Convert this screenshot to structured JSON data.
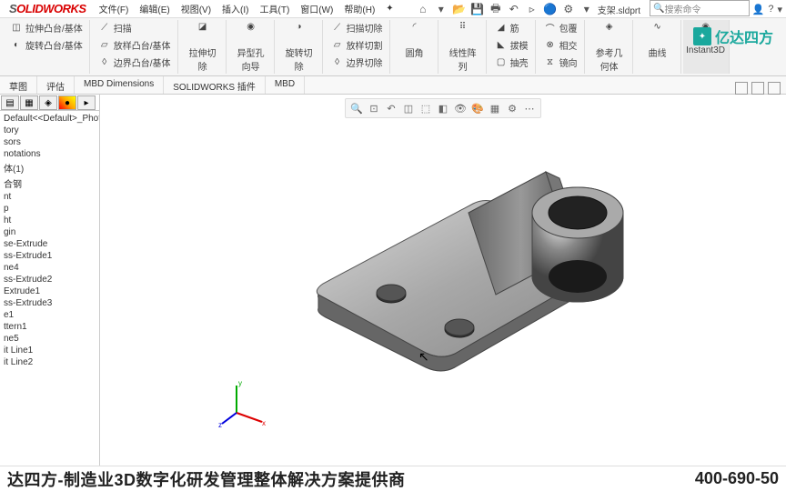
{
  "logo": {
    "solid": "OLID",
    "works": "WORKS"
  },
  "menus": [
    "文件(F)",
    "编辑(E)",
    "视图(V)",
    "插入(I)",
    "工具(T)",
    "窗口(W)",
    "帮助(H)"
  ],
  "fileName": "支架.sldprt",
  "searchPlaceholder": "搜索命令",
  "ribbon": {
    "g1": [
      [
        "拉伸凸台/基体",
        "extrude-boss"
      ],
      [
        "旋转凸台/基体",
        "revolve-boss"
      ]
    ],
    "g1b": [
      [
        "扫描",
        "sweep"
      ],
      [
        "放样凸台/基体",
        "loft"
      ],
      [
        "边界凸台/基体",
        "boundary"
      ]
    ],
    "g2": [
      [
        "拉伸切除",
        "cut-extrude"
      ],
      [
        "异型孔向导",
        "hole-wizard"
      ],
      [
        "旋转切除",
        "cut-revolve"
      ]
    ],
    "g2b": [
      [
        "扫描切除",
        "cut-sweep"
      ],
      [
        "放样切割",
        "cut-loft"
      ],
      [
        "边界切除",
        "cut-boundary"
      ]
    ],
    "g3": [
      [
        "圆角",
        "fillet"
      ],
      [
        "线性阵列",
        "pattern"
      ]
    ],
    "g4": [
      [
        "筋",
        "rib"
      ],
      [
        "拔模",
        "draft"
      ],
      [
        "抽壳",
        "shell"
      ]
    ],
    "g4b": [
      [
        "包覆",
        "wrap"
      ],
      [
        "相交",
        "intersect"
      ],
      [
        "镜向",
        "mirror"
      ]
    ],
    "g5": [
      [
        "参考几何体",
        "ref-geom"
      ],
      [
        "曲线",
        "curves"
      ]
    ],
    "instant3d": "Instant3D"
  },
  "cmdTabs": [
    "草图",
    "评估",
    "MBD Dimensions",
    "SOLIDWORKS 插件",
    "MBD"
  ],
  "tree": [
    "Default<<Default>_PhotoWork",
    "tory",
    "sors",
    "notations",
    "体(1)",
    "合钢",
    "nt",
    "p",
    "ht",
    "gin",
    "se-Extrude",
    "ss-Extrude1",
    "ne4",
    "ss-Extrude2",
    "Extrude1",
    "ss-Extrude3",
    "e1",
    "ttern1",
    "ne5",
    "it Line1",
    "it Line2"
  ],
  "watermark": "亿达四方",
  "footer": {
    "text": "达四方-制造业3D数字化研发管理整体解决方案提供商",
    "phone": "400-690-50"
  }
}
